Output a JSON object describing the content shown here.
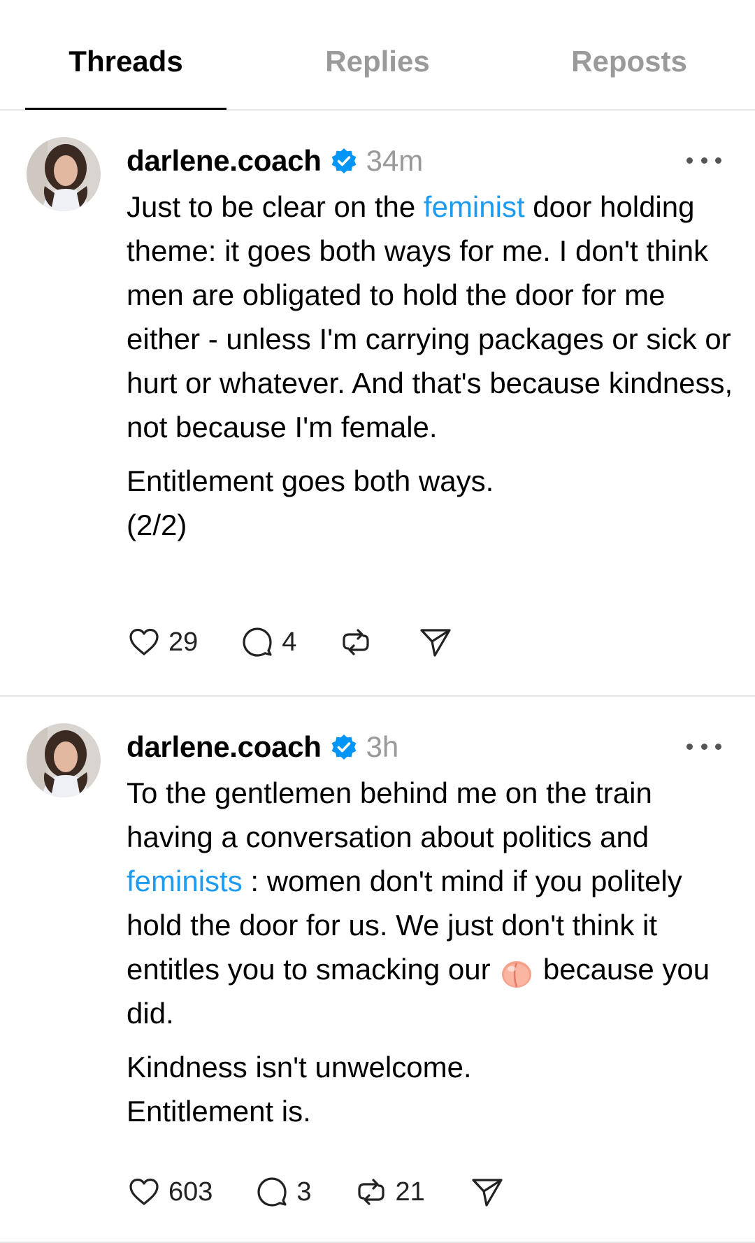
{
  "tabs": {
    "threads": "Threads",
    "replies": "Replies",
    "reposts": "Reposts",
    "active": "Threads"
  },
  "colors": {
    "link": "#1d9bf0",
    "verified": "#0095f6",
    "muted": "#999999"
  },
  "posts": [
    {
      "username": "darlene.coach",
      "verified": true,
      "time": "34m",
      "body": {
        "p1_a": "Just to be clear on the ",
        "p1_link": "feminist",
        "p1_b": " door holding theme:  it goes both ways for me.  I don't think men are obligated to hold the door for me either - unless I'm carrying packages or sick or hurt or whatever. And that's because kindness, not because I'm female.",
        "p2_line1": "Entitlement goes both ways.",
        "p2_line2": "(2/2)"
      },
      "likes": "29",
      "replies": "4",
      "reposts": ""
    },
    {
      "username": "darlene.coach",
      "verified": true,
      "time": "3h",
      "body": {
        "p1_a": "To the gentlemen behind me on the train having a conversation about politics and ",
        "p1_link": "feminists",
        "p1_b": " :  women don't mind if you politely hold the door for us.  We just don't think it entitles you to smacking our ",
        "p1_emoji": "peach-emoji",
        "p1_c": " because you did.",
        "p2_line1": "Kindness isn't unwelcome.",
        "p2_line2": "Entitlement is."
      },
      "likes": "603",
      "replies": "3",
      "reposts": "21"
    }
  ]
}
